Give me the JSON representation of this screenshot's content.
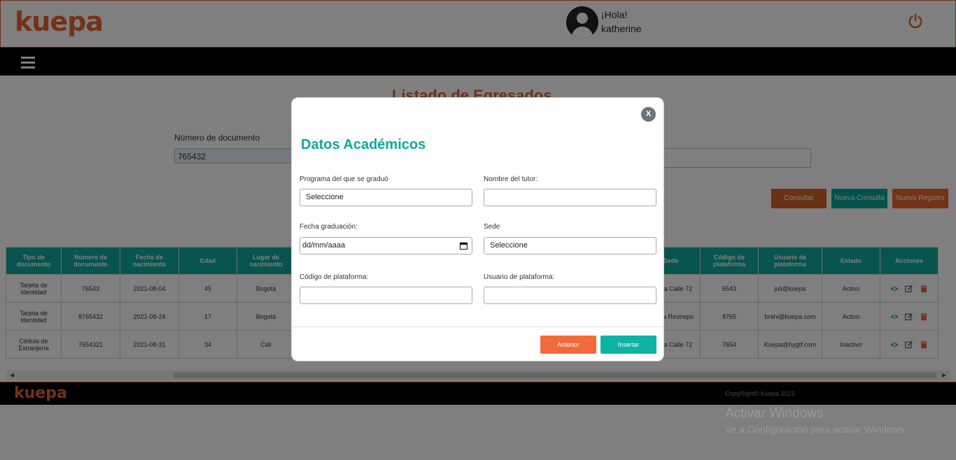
{
  "header": {
    "logo": "kuepa",
    "greeting": "¡Hola!",
    "username": "katherine"
  },
  "page": {
    "title": "Listado de Egresados",
    "doc_label": "Número de documento",
    "doc_value": "765432",
    "buttons": {
      "consultar": "Consultar",
      "nueva_consulta": "Nueva Consulta",
      "nuevo_registro": "Nuevo Registro"
    }
  },
  "table": {
    "left_headers": [
      "Tipo de documento",
      "Número de documento",
      "Fecha de nacimiento",
      "Edad",
      "Lugar de nacimiento"
    ],
    "right_headers": [
      "Sede",
      "Código de plataforma",
      "Usuario de plataforma",
      "Estado",
      "Acciones"
    ],
    "rows": [
      {
        "tipo": "Tarjeta de Identidad",
        "numero": "76543",
        "fecha": "2021-08-04",
        "edad": "45",
        "lugar": "Bogotá",
        "sede": "Kuepa Calle 72",
        "codigo": "6543",
        "usuario": "juli@kuepa",
        "estado": "Activo"
      },
      {
        "tipo": "Tarjeta de Identidad",
        "numero": "8765432",
        "fecha": "2021-08-24",
        "edad": "17",
        "lugar": "Bogotá",
        "sede": "Kuepa Restrepo",
        "codigo": "8765",
        "usuario": "brahi@kuepa.com",
        "estado": "Activo"
      },
      {
        "tipo": "Cédula de Extranjería",
        "numero": "7654321",
        "fecha": "2021-08-31",
        "edad": "34",
        "lugar": "Cali",
        "sede": "Kuepa Calle 72",
        "codigo": "7654",
        "usuario": "Kuepa@hygtf.com",
        "estado": "Inactivo"
      }
    ]
  },
  "footer": {
    "logo": "kuepa",
    "copyright": "CopyRight© Kuepa 2021"
  },
  "watermark": {
    "line1": "Activar Windows",
    "line2": "Ve a Configuración para activar Windows."
  },
  "modal": {
    "close": "X",
    "title": "Datos Académicos",
    "programa_label": "Programa del que se graduó",
    "programa_value": "Seleccione",
    "tutor_label": "Nombre del tutor:",
    "tutor_value": "",
    "fecha_label": "Fecha graduación:",
    "fecha_value": "dd/mm/aaaa",
    "sede_label": "Sede",
    "sede_value": "Seleccione",
    "codigo_label": "Código de plataforma:",
    "codigo_value": "",
    "usuario_label": "Usuario de plataforma:",
    "usuario_value": "",
    "btn_anterior": "Anterior",
    "btn_insertar": "Insertar"
  },
  "colors": {
    "brand_orange": "#e8652f",
    "teal": "#10a89c",
    "overlay": "rgba(0,0,0,0.5)"
  },
  "icons": [
    "user-avatar-icon",
    "power-icon",
    "hamburger-menu-icon",
    "eye-icon",
    "edit-icon",
    "trash-icon",
    "calendar-icon",
    "close-icon"
  ]
}
